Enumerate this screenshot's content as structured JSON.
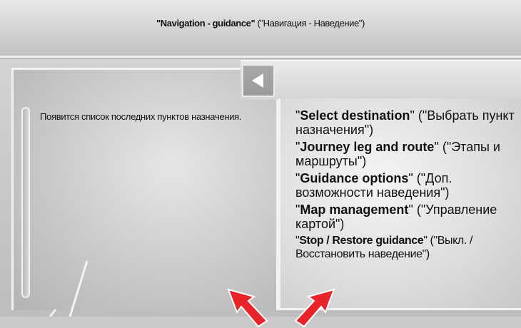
{
  "header": {
    "title_en": "\"Navigation - guidance\"",
    "title_ru": " (\"Навигация - Наведение\")"
  },
  "left_panel": {
    "message": "Появится список последних пунктов назначения."
  },
  "menu": {
    "items": [
      {
        "open": "\"",
        "en": "Select destination",
        "close": "\"",
        "ru": " (\"Выбрать пункт назначения\")"
      },
      {
        "open": "\"",
        "en": "Journey leg and route",
        "close": "\"",
        "ru": " (\"Этапы и маршруты\")"
      },
      {
        "open": "\"",
        "en": "Guidance options",
        "close": "\"",
        "ru": " (\"Доп. возможности наведения\")"
      },
      {
        "open": "\"",
        "en": "Map management",
        "close": "\"",
        "ru": " (\"Управление картой\")"
      },
      {
        "open": "\"",
        "en": "Stop / Restore guidance",
        "close": "\"",
        "ru": " (\"Выкл. / Восстановить наведение\")"
      }
    ]
  },
  "icons": {
    "back": "left-triangle-icon",
    "arrows": "red-arrow-icon"
  },
  "colors": {
    "arrow": "#e8232a",
    "background": "#c9c9c9"
  }
}
